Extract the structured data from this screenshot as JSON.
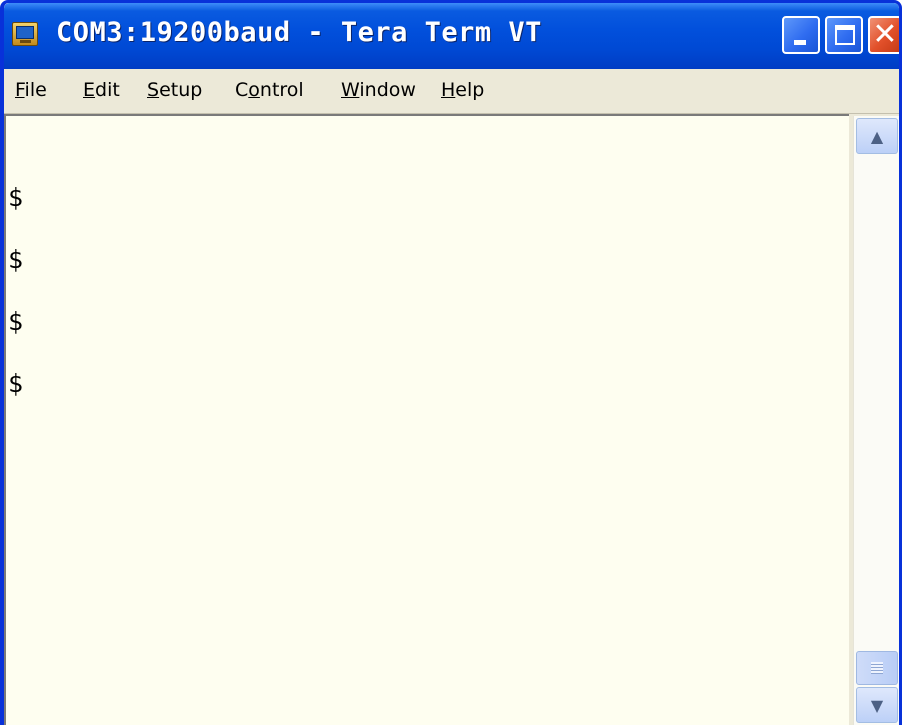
{
  "window": {
    "title": "COM3:19200baud - Tera Term VT",
    "icon": "tera-term-app-icon",
    "controls": {
      "minimize": "minimize-icon",
      "maximize": "maximize-icon",
      "close_glyph": "✕"
    }
  },
  "menu": {
    "items": [
      {
        "key": "F",
        "rest": "ile"
      },
      {
        "key": "E",
        "rest": "dit"
      },
      {
        "key": "S",
        "rest": "etup"
      },
      {
        "pre": "C",
        "key": "o",
        "rest": "ntrol"
      },
      {
        "key": "W",
        "rest": "indow"
      },
      {
        "key": "H",
        "rest": "elp"
      }
    ]
  },
  "terminal": {
    "lines": [
      "$",
      "$",
      "$",
      "$"
    ],
    "background": "#fefef0"
  },
  "scrollbar": {
    "up_icon": "▲",
    "down_icon": "▼"
  },
  "colors": {
    "titlebar": "#0250dc",
    "close_button": "#e2502a",
    "frame": "#0831d9"
  }
}
